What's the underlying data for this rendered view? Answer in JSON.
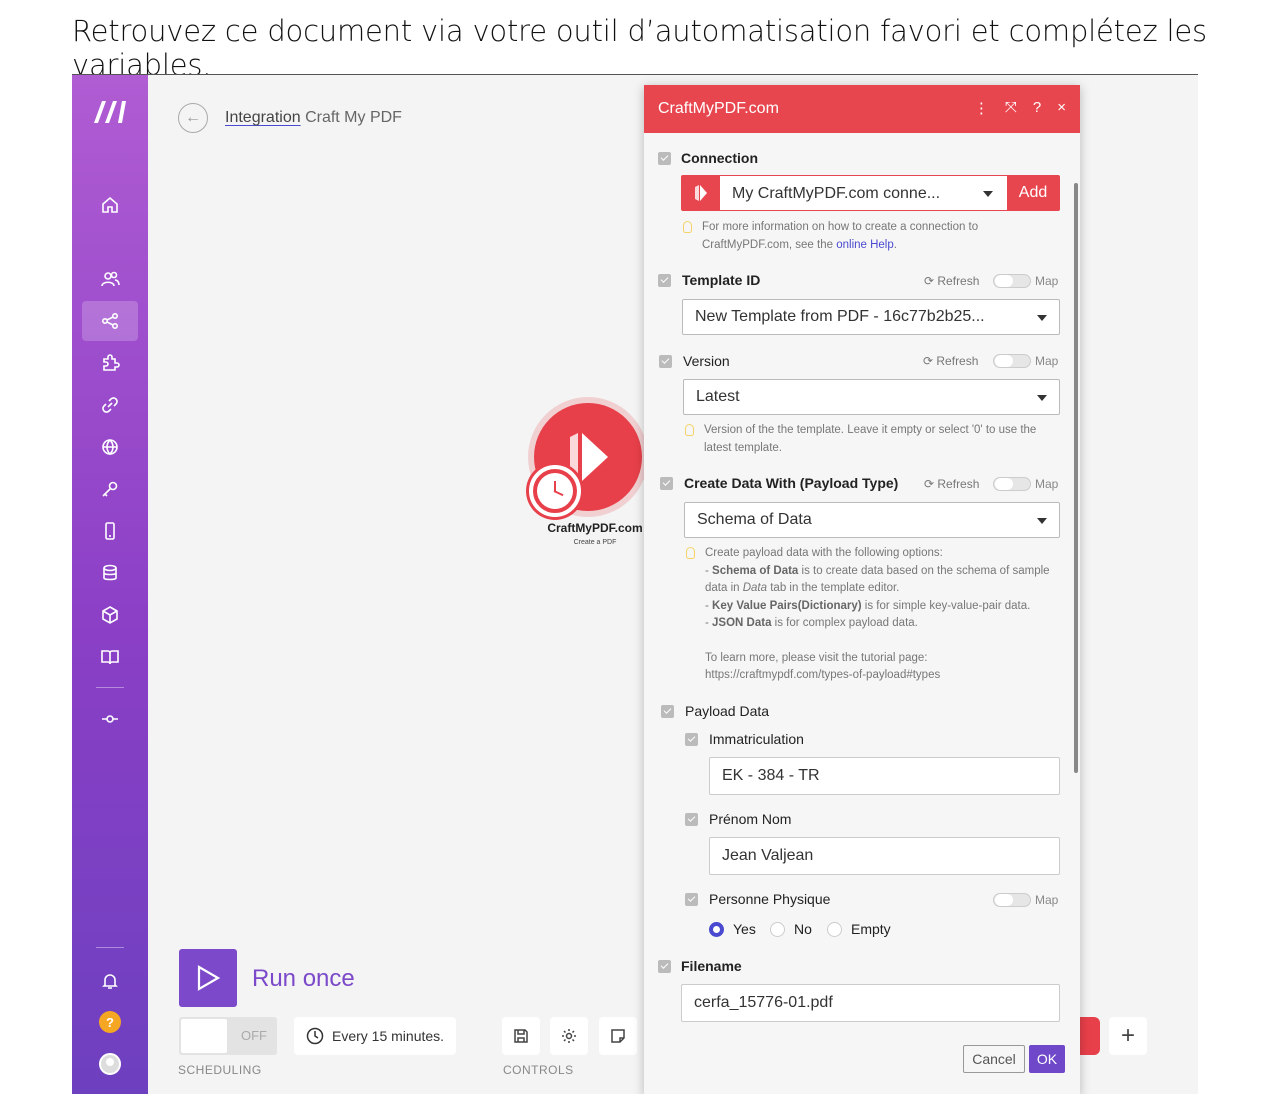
{
  "caption": "Retrouvez ce document via votre outil d’automatisation favori et complétez les variables.",
  "breadcrumb": {
    "link": "Integration",
    "name": "Craft My PDF"
  },
  "module": {
    "name": "CraftMyPDF.com",
    "subtitle": "Create a PDF"
  },
  "run": {
    "label": "Run once"
  },
  "scheduling": {
    "toggle": "OFF",
    "frequency": "Every 15 minutes.",
    "section_label": "SCHEDULING"
  },
  "controls": {
    "section_label": "CONTROLS"
  },
  "dialog": {
    "title": "CraftMyPDF.com",
    "tools": [
      "⋮",
      "⤧",
      "?",
      "×"
    ],
    "connection": {
      "label": "Connection",
      "value": "My CraftMyPDF.com conne...",
      "add": "Add",
      "help_prefix": "For more information on how to create a connection to CraftMyPDF.com, see the ",
      "help_link": "online Help",
      "help_suffix": "."
    },
    "refresh": "Refresh",
    "map": "Map",
    "template_id": {
      "label": "Template ID",
      "value": "New Template from PDF - 16c77b2b25..."
    },
    "version": {
      "label": "Version",
      "value": "Latest",
      "help": "Version of the the template. Leave it empty or select '0' to use the latest template."
    },
    "create_data": {
      "label": "Create Data With (Payload Type)",
      "value": "Schema of Data",
      "help_intro": "Create payload data with the following options:",
      "opt1_b": "Schema of Data",
      "opt1_a": " is to create data based on the schema of sample data in ",
      "opt1_i": "Data",
      "opt1_c": " tab in the template editor.",
      "opt2_b": "Key Value Pairs(Dictionary)",
      "opt2_a": " is for simple key-value-pair data.",
      "opt3_b": "JSON Data",
      "opt3_a": " is for complex payload data.",
      "learn": "To learn more, please visit the tutorial page:",
      "url": "https://craftmypdf.com/types-of-payload#types"
    },
    "payload": {
      "label": "Payload Data",
      "immat_label": "Immatriculation",
      "immat_value": "EK - 384 - TR",
      "name_label": "Prénom Nom",
      "name_value": "Jean Valjean",
      "person_label": "Personne Physique",
      "radio_yes": "Yes",
      "radio_no": "No",
      "radio_empty": "Empty"
    },
    "filename": {
      "label": "Filename",
      "value": "cerfa_15776-01.pdf"
    },
    "cancel": "Cancel",
    "ok": "OK"
  }
}
